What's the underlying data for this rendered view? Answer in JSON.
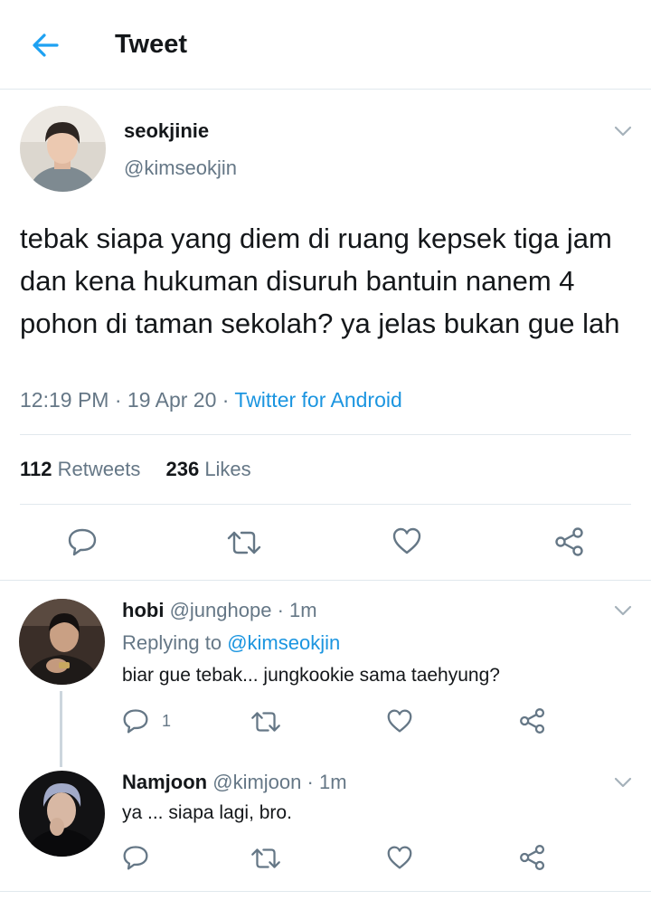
{
  "header": {
    "title": "Tweet"
  },
  "main_tweet": {
    "display_name": "seokjinie",
    "handle": "@kimseokjin",
    "text": "tebak siapa yang diem di ruang kepsek tiga jam dan kena hukuman disuruh bantuin nanem 4 pohon di taman sekolah? ya jelas bukan gue lah",
    "time": "12:19 PM",
    "date": "19 Apr 20",
    "separator": "·",
    "source": "Twitter for Android",
    "retweets_count": "112",
    "retweets_label": "Retweets",
    "likes_count": "236",
    "likes_label": "Likes"
  },
  "replies": [
    {
      "display_name": "hobi",
      "handle": "@junghope",
      "separator": "·",
      "time": "1m",
      "replying_prefix": "Replying to",
      "replying_handle": "@kimseokjin",
      "text": "biar gue tebak... jungkookie sama taehyung?",
      "reply_count": "1"
    },
    {
      "display_name": "Namjoon",
      "handle": "@kimjoon",
      "separator": "·",
      "time": "1m",
      "text": "ya ... siapa lagi, bro."
    }
  ],
  "icons": {
    "back": "arrow-left-icon",
    "chevron": "chevron-down-icon",
    "reply": "speech-bubble-icon",
    "retweet": "retweet-icon",
    "like": "heart-icon",
    "share": "share-icon"
  },
  "colors": {
    "accent": "#1da1f2",
    "link": "#1b95e0",
    "secondary_text": "#657786",
    "divider": "#e1e8ed"
  }
}
